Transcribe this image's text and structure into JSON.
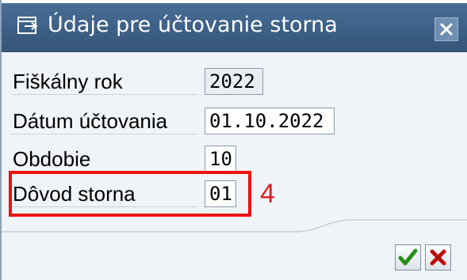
{
  "dialog": {
    "title": "Údaje pre účtovanie storna",
    "title_icon": "dialog-window-icon",
    "close_icon": "close-x-icon"
  },
  "fields": [
    {
      "label": "Fiškálny rok",
      "value": "2022",
      "editable": false
    },
    {
      "label": "Dátum účtovania",
      "value": "01.10.2022",
      "editable": true
    },
    {
      "label": "Obdobie",
      "value": "10",
      "editable": true
    },
    {
      "label": "Dôvod storna",
      "value": "01",
      "editable": true
    }
  ],
  "annotation": {
    "text": "4",
    "color": "#e02020"
  },
  "buttons": {
    "confirm_icon": "green-checkmark-icon",
    "cancel_icon": "red-x-icon"
  },
  "colors": {
    "titlebar": "#3c5f85",
    "highlight": "#ee1111",
    "confirm": "#2e9a1e",
    "cancel": "#cc1010"
  }
}
